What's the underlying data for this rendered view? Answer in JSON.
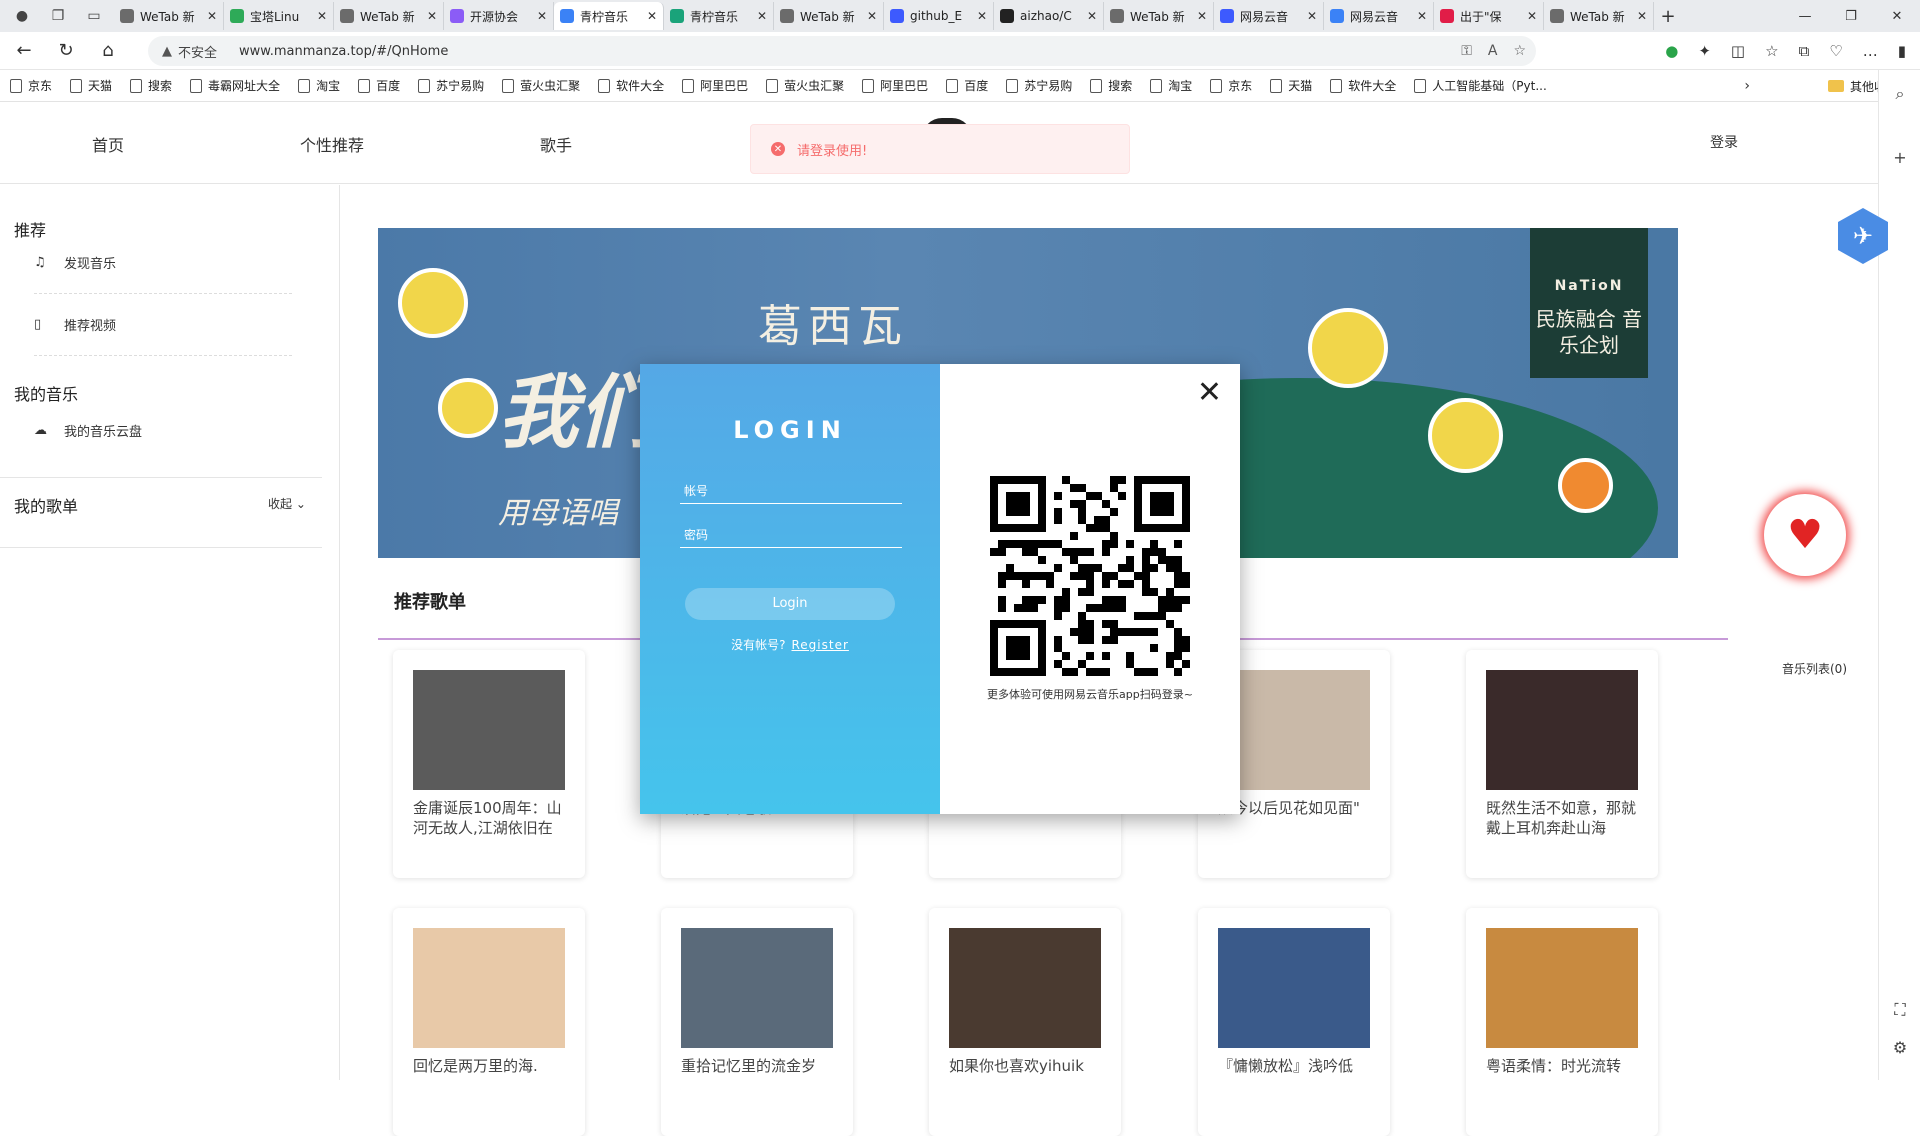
{
  "browser": {
    "tabs": [
      {
        "title": "WeTab 新",
        "color": "#6b6b6b"
      },
      {
        "title": "宝塔Linu",
        "color": "#2eaa58"
      },
      {
        "title": "WeTab 新",
        "color": "#6b6b6b"
      },
      {
        "title": "开源协会",
        "color": "#8b5cf6"
      },
      {
        "title": "青柠音乐",
        "color": "#3b82f6",
        "active": true
      },
      {
        "title": "青柠音乐",
        "color": "#1aa37a"
      },
      {
        "title": "WeTab 新",
        "color": "#6b6b6b"
      },
      {
        "title": "github_E",
        "color": "#3d5afe"
      },
      {
        "title": "aizhao/C",
        "color": "#222222"
      },
      {
        "title": "WeTab 新",
        "color": "#6b6b6b"
      },
      {
        "title": "网易云音",
        "color": "#3d5afe"
      },
      {
        "title": "网易云音",
        "color": "#3b82f6"
      },
      {
        "title": "出于\"保",
        "color": "#e11d48"
      },
      {
        "title": "WeTab 新",
        "color": "#6b6b6b"
      }
    ],
    "insecure_label": "不安全",
    "url": "www.manmanza.top/#/QnHome",
    "bookmarks": [
      "京东",
      "天猫",
      "搜索",
      "毒霸网址大全",
      "淘宝",
      "百度",
      "苏宁易购",
      "萤火虫汇聚",
      "软件大全",
      "阿里巴巴",
      "萤火虫汇聚",
      "阿里巴巴",
      "百度",
      "苏宁易购",
      "搜索",
      "淘宝",
      "京东",
      "天猫",
      "软件大全",
      "人工智能基础（Pyt..."
    ],
    "other_bookmarks": "其他收藏夹"
  },
  "nav": {
    "home": "首页",
    "personal": "个性推荐",
    "singer": "歌手",
    "login": "登录"
  },
  "toast": {
    "text": "请登录使用!"
  },
  "sidebar": {
    "recommend_heading": "推荐",
    "discover": "发现音乐",
    "video": "推荐视频",
    "my_music_heading": "我的音乐",
    "cloud": "我的音乐云盘",
    "my_playlist": "我的歌单",
    "collapse": "收起"
  },
  "banner": {
    "artist": "葛西瓦",
    "headline": "我们",
    "subline": "用母语唱",
    "badge_logo": "NaTioN",
    "badge_text": "民族融合 音乐企划"
  },
  "section": {
    "title": "推荐歌单"
  },
  "cards_row1": [
    {
      "title": "金庸诞辰100周年：山河无故人,江湖依旧在",
      "color": "#5b5b5b"
    },
    {
      "title": "溜鬼经典老歌",
      "color": "#8a7a6a"
    },
    {
      "title": "",
      "color": "#9aa0a6"
    },
    {
      "title": "从今以后见花如见面\"",
      "color": "#c9b9a8"
    },
    {
      "title": "既然生活不如意，那就戴上耳机奔赴山海",
      "color": "#3a2a2a"
    }
  ],
  "cards_row2": [
    {
      "title": "回忆是两万里的海.",
      "color": "#e8c9a8"
    },
    {
      "title": "重拾记忆里的流金岁",
      "color": "#5a6a7a"
    },
    {
      "title": "如果你也喜欢yihuik",
      "color": "#4a3a30"
    },
    {
      "title": "『慵懒放松』浅吟低",
      "color": "#3a5a8a"
    },
    {
      "title": "粤语柔情：时光流转",
      "color": "#c88a40"
    }
  ],
  "right": {
    "playlist_count": "音乐列表(0)"
  },
  "modal": {
    "title": "LOGIN",
    "account_placeholder": "帐号",
    "password_placeholder": "密码",
    "login_button": "Login",
    "no_account": "没有帐号?",
    "register": "Register",
    "qr_caption": "更多体验可使用网易云音乐app扫码登录~"
  }
}
